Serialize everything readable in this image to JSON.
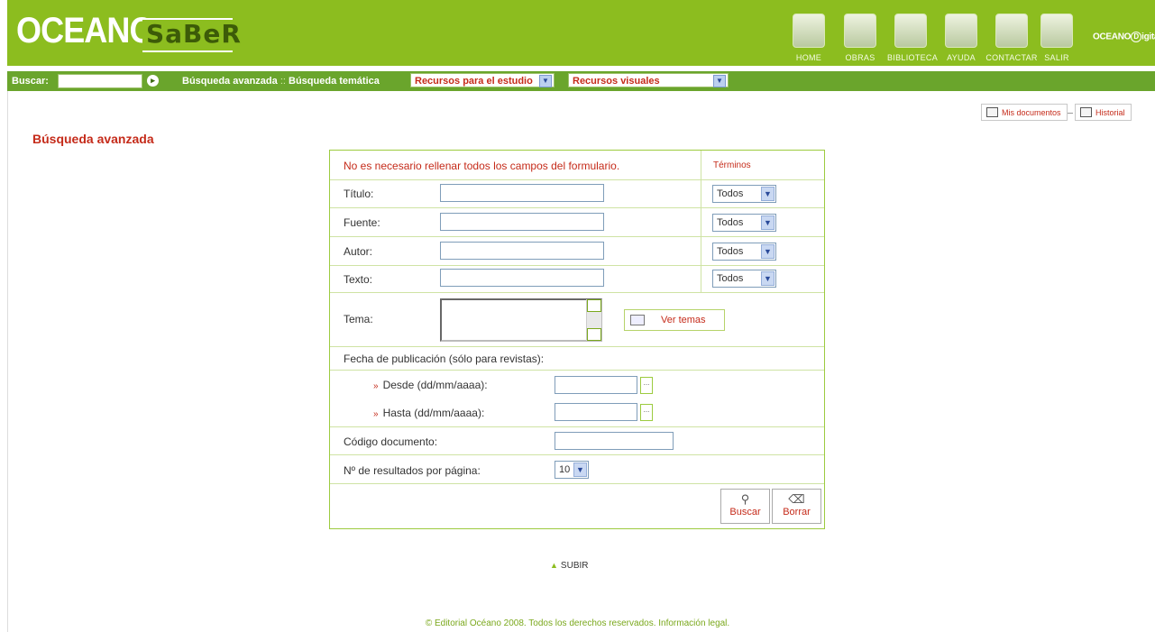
{
  "header": {
    "logo_main": "OCEANO",
    "logo_sub": "SaBeR",
    "nav": [
      {
        "label": "HOME",
        "icon": "home-icon"
      },
      {
        "label": "OBRAS",
        "icon": "book-icon"
      },
      {
        "label": "BIBLIOTECA",
        "icon": "library-icon"
      },
      {
        "label": "AYUDA",
        "icon": "help-icon"
      },
      {
        "label": "CONTACTAR",
        "icon": "envelope-icon"
      },
      {
        "label": "SALIR",
        "icon": "door-icon"
      }
    ],
    "brand_right_a": "OCEANO",
    "brand_right_b": "igital",
    "brand_right_circle": "D"
  },
  "searchbar": {
    "label": "Buscar:",
    "input_value": "",
    "go_symbol": "▸",
    "advanced_link": "Búsqueda avanzada",
    "separator": "::",
    "thematic_link": "Búsqueda temática",
    "select1": "Recursos para el estudio",
    "select2": "Recursos visuales"
  },
  "docs": {
    "mis_documentos": "Mis documentos",
    "historial": "Historial"
  },
  "page_title": "Búsqueda avanzada",
  "form": {
    "notice": "No es necesario rellenar todos los campos del formulario.",
    "terms_header": "Términos",
    "fields": {
      "titulo": {
        "label": "Título:",
        "value": "",
        "terms": "Todos"
      },
      "fuente": {
        "label": "Fuente:",
        "value": "",
        "terms": "Todos"
      },
      "autor": {
        "label": "Autor:",
        "value": "",
        "terms": "Todos"
      },
      "texto": {
        "label": "Texto:",
        "value": "",
        "terms": "Todos"
      }
    },
    "tema_label": "Tema:",
    "ver_temas": "Ver temas",
    "fecha_label": "Fecha de publicación (sólo para revistas):",
    "desde_label": "Desde (dd/mm/aaaa):",
    "hasta_label": "Hasta (dd/mm/aaaa):",
    "date_picker": "...",
    "codigo_label": "Código documento:",
    "resultados_label": "Nº de resultados por página:",
    "resultados_value": "10",
    "buscar": "Buscar",
    "borrar": "Borrar"
  },
  "subir": "SUBIR",
  "footer": "© Editorial Océano 2008. Todos los derechos reservados. Información legal.",
  "colors": {
    "header_green": "#8cbd1f",
    "bar_green": "#6aa52c",
    "accent_red": "#c52b1a",
    "border_green": "#9ccb3f"
  }
}
